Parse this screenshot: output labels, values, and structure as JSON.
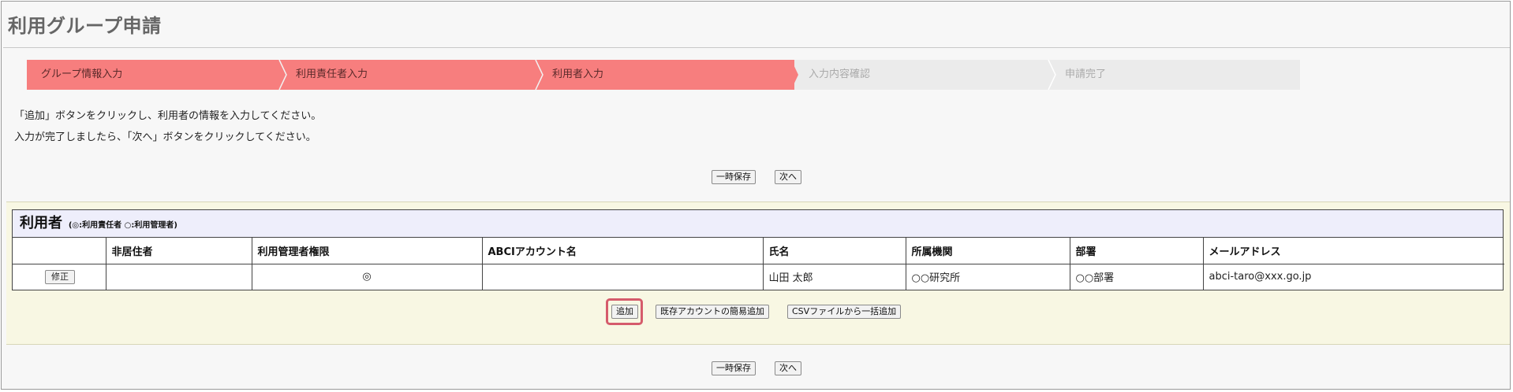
{
  "page": {
    "title": "利用グループ申請"
  },
  "steps": [
    {
      "label": "グループ情報入力",
      "state": "done"
    },
    {
      "label": "利用責任者入力",
      "state": "done"
    },
    {
      "label": "利用者入力",
      "state": "current"
    },
    {
      "label": "入力内容確認",
      "state": "todo"
    },
    {
      "label": "申請完了",
      "state": "todo"
    }
  ],
  "instructions": {
    "line1": "「追加」ボタンをクリックし、利用者の情報を入力してください。",
    "line2": "入力が完了しましたら、「次へ」ボタンをクリックしてください。"
  },
  "top_actions": {
    "save_label": "一時保存",
    "next_label": "次へ"
  },
  "users_section": {
    "title": "利用者",
    "legend": "(◎:利用責任者 ○:利用管理者)",
    "columns": [
      "",
      "非居住者",
      "利用管理者権限",
      "ABCIアカウント名",
      "氏名",
      "所属機関",
      "部署",
      "メールアドレス"
    ],
    "rows": [
      {
        "edit_label": "修正",
        "non_resident": "",
        "admin_privilege": "◎",
        "abci_account": "",
        "name": "山田 太郎",
        "organization": "○○研究所",
        "department": "○○部署",
        "email": "abci-taro@xxx.go.jp"
      }
    ],
    "add_label": "追加",
    "quick_add_label": "既存アカウントの簡易追加",
    "csv_add_label": "CSVファイルから一括追加"
  },
  "bottom_actions": {
    "save_label": "一時保存",
    "next_label": "次へ"
  },
  "colors": {
    "step_active": "#f77e7e",
    "step_inactive": "#ebebeb",
    "panel_bg": "#f8f7e3",
    "caption_bg": "#eeeefb",
    "highlight": "#d55b6b"
  }
}
